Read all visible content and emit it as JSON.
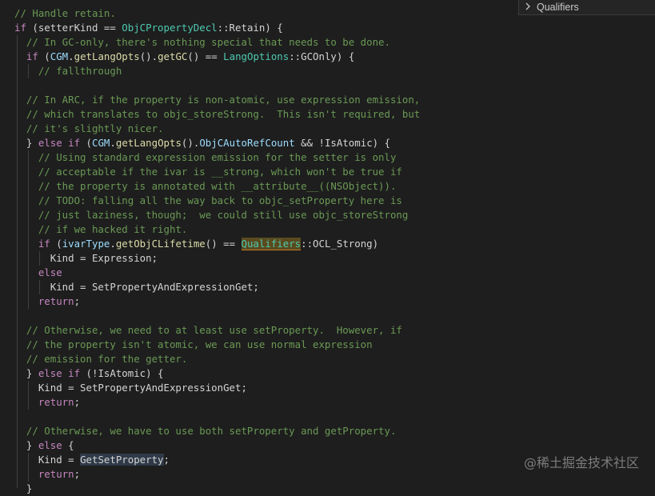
{
  "find_widget": {
    "text": "Qualifiers",
    "expand_icon": "chevron-right-icon"
  },
  "watermark": "@稀土掘金技术社区",
  "code_lines": [
    [
      {
        "t": "// Handle retain.",
        "c": "comment"
      }
    ],
    [
      {
        "t": "if",
        "c": "keyword"
      },
      {
        "t": " (setterKind == ",
        "c": "plain"
      },
      {
        "t": "ObjCPropertyDecl",
        "c": "type"
      },
      {
        "t": "::Retain) {",
        "c": "plain"
      }
    ],
    [
      {
        "t": "  // In GC-only, there's nothing special that needs to be done.",
        "c": "comment"
      }
    ],
    [
      {
        "t": "  ",
        "c": "plain"
      },
      {
        "t": "if",
        "c": "keyword"
      },
      {
        "t": " (",
        "c": "plain"
      },
      {
        "t": "CGM",
        "c": "var"
      },
      {
        "t": ".",
        "c": "plain"
      },
      {
        "t": "getLangOpts",
        "c": "func"
      },
      {
        "t": "().",
        "c": "plain"
      },
      {
        "t": "getGC",
        "c": "func"
      },
      {
        "t": "() == ",
        "c": "plain"
      },
      {
        "t": "LangOptions",
        "c": "type"
      },
      {
        "t": "::GCOnly) {",
        "c": "plain"
      }
    ],
    [
      {
        "t": "    // fallthrough",
        "c": "comment"
      }
    ],
    [],
    [
      {
        "t": "  // In ARC, if the property is non-atomic, use expression emission,",
        "c": "comment"
      }
    ],
    [
      {
        "t": "  // which translates to objc_storeStrong.  This isn't required, but",
        "c": "comment"
      }
    ],
    [
      {
        "t": "  // it's slightly nicer.",
        "c": "comment"
      }
    ],
    [
      {
        "t": "  } ",
        "c": "plain"
      },
      {
        "t": "else",
        "c": "keyword"
      },
      {
        "t": " ",
        "c": "plain"
      },
      {
        "t": "if",
        "c": "keyword"
      },
      {
        "t": " (",
        "c": "plain"
      },
      {
        "t": "CGM",
        "c": "var"
      },
      {
        "t": ".",
        "c": "plain"
      },
      {
        "t": "getLangOpts",
        "c": "func"
      },
      {
        "t": "().",
        "c": "plain"
      },
      {
        "t": "ObjCAutoRefCount",
        "c": "var"
      },
      {
        "t": " && !IsAtomic) {",
        "c": "plain"
      }
    ],
    [
      {
        "t": "    // Using standard expression emission for the setter is only",
        "c": "comment"
      }
    ],
    [
      {
        "t": "    // acceptable if the ivar is __strong, which won't be true if",
        "c": "comment"
      }
    ],
    [
      {
        "t": "    // the property is annotated with __attribute__((NSObject)).",
        "c": "comment"
      }
    ],
    [
      {
        "t": "    // TODO: falling all the way back to objc_setProperty here is",
        "c": "comment"
      }
    ],
    [
      {
        "t": "    // just laziness, though;  we could still use objc_storeStrong",
        "c": "comment"
      }
    ],
    [
      {
        "t": "    // if we hacked it right.",
        "c": "comment"
      }
    ],
    [
      {
        "t": "    ",
        "c": "plain"
      },
      {
        "t": "if",
        "c": "keyword"
      },
      {
        "t": " (",
        "c": "plain"
      },
      {
        "t": "ivarType",
        "c": "var"
      },
      {
        "t": ".",
        "c": "plain"
      },
      {
        "t": "getObjCLifetime",
        "c": "func"
      },
      {
        "t": "() == ",
        "c": "plain"
      },
      {
        "t": "Qualifiers",
        "c": "type hl"
      },
      {
        "t": "::OCL_Strong)",
        "c": "plain"
      }
    ],
    [
      {
        "t": "      Kind = Expression;",
        "c": "plain"
      }
    ],
    [
      {
        "t": "    ",
        "c": "plain"
      },
      {
        "t": "else",
        "c": "keyword"
      }
    ],
    [
      {
        "t": "      Kind = SetPropertyAndExpressionGet;",
        "c": "plain"
      }
    ],
    [
      {
        "t": "    ",
        "c": "plain"
      },
      {
        "t": "return",
        "c": "keyword"
      },
      {
        "t": ";",
        "c": "plain"
      }
    ],
    [],
    [
      {
        "t": "  // Otherwise, we need to at least use setProperty.  However, if",
        "c": "comment"
      }
    ],
    [
      {
        "t": "  // the property isn't atomic, we can use normal expression",
        "c": "comment"
      }
    ],
    [
      {
        "t": "  // emission for the getter.",
        "c": "comment"
      }
    ],
    [
      {
        "t": "  } ",
        "c": "plain"
      },
      {
        "t": "else",
        "c": "keyword"
      },
      {
        "t": " ",
        "c": "plain"
      },
      {
        "t": "if",
        "c": "keyword"
      },
      {
        "t": " (!IsAtomic) {",
        "c": "plain"
      }
    ],
    [
      {
        "t": "    Kind = SetPropertyAndExpressionGet;",
        "c": "plain"
      }
    ],
    [
      {
        "t": "    ",
        "c": "plain"
      },
      {
        "t": "return",
        "c": "keyword"
      },
      {
        "t": ";",
        "c": "plain"
      }
    ],
    [],
    [
      {
        "t": "  // Otherwise, we have to use both setProperty and getProperty.",
        "c": "comment"
      }
    ],
    [
      {
        "t": "  } ",
        "c": "plain"
      },
      {
        "t": "else",
        "c": "keyword"
      },
      {
        "t": " {",
        "c": "plain"
      }
    ],
    [
      {
        "t": "    Kind = ",
        "c": "plain"
      },
      {
        "t": "GetSetProperty",
        "c": "plain hl2"
      },
      {
        "t": ";",
        "c": "plain"
      }
    ],
    [
      {
        "t": "    ",
        "c": "plain"
      },
      {
        "t": "return",
        "c": "keyword"
      },
      {
        "t": ";",
        "c": "plain"
      }
    ],
    [
      {
        "t": "  }",
        "c": "plain"
      }
    ]
  ]
}
